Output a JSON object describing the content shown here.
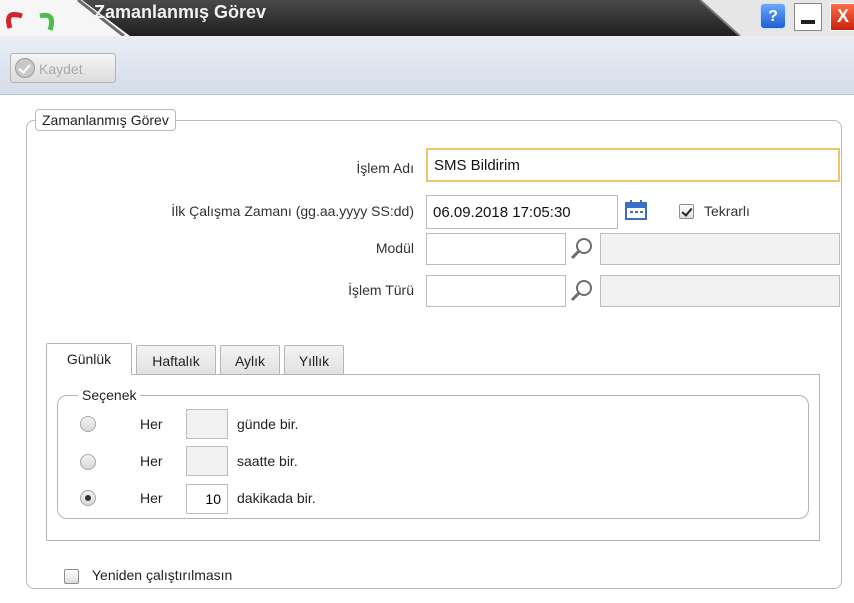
{
  "window": {
    "title": "Zamanlanmış Görev",
    "help_glyph": "?",
    "close_glyph": "X"
  },
  "toolbar": {
    "save_label": "Kaydet"
  },
  "form": {
    "legend": "Zamanlanmış Görev",
    "islem_adi_label": "İşlem Adı",
    "islem_adi_value": "SMS Bildirim",
    "ilk_calisma_label": "İlk Çalışma Zamanı (gg.aa.yyyy SS:dd)",
    "ilk_calisma_value": "06.09.2018 17:05:30",
    "tekrarli_label": "Tekrarlı",
    "tekrarli_checked": true,
    "modul_label": "Modül",
    "modul_value": "",
    "modul_desc": "",
    "islem_turu_label": "İşlem Türü",
    "islem_turu_value": "",
    "islem_turu_desc": ""
  },
  "tabs": [
    {
      "label": "Günlük",
      "active": true
    },
    {
      "label": "Haftalık",
      "active": false
    },
    {
      "label": "Aylık",
      "active": false
    },
    {
      "label": "Yıllık",
      "active": false
    }
  ],
  "options": {
    "legend": "Seçenek",
    "items": [
      {
        "prefix": "Her",
        "value": "",
        "suffix": "günde bir.",
        "selected": false
      },
      {
        "prefix": "Her",
        "value": "",
        "suffix": "saatte bir.",
        "selected": false
      },
      {
        "prefix": "Her",
        "value": "10",
        "suffix": "dakikada bir.",
        "selected": true
      }
    ]
  },
  "yeniden": {
    "label": "Yeniden çalıştırılmasın",
    "checked": false
  },
  "colors": {
    "titlebar": "#2b2b2b",
    "toolbar": "#dfe5ee",
    "active_input_border": "#f0c36d",
    "help_button": "#2f6fe0",
    "close_button": "#e0401c"
  }
}
